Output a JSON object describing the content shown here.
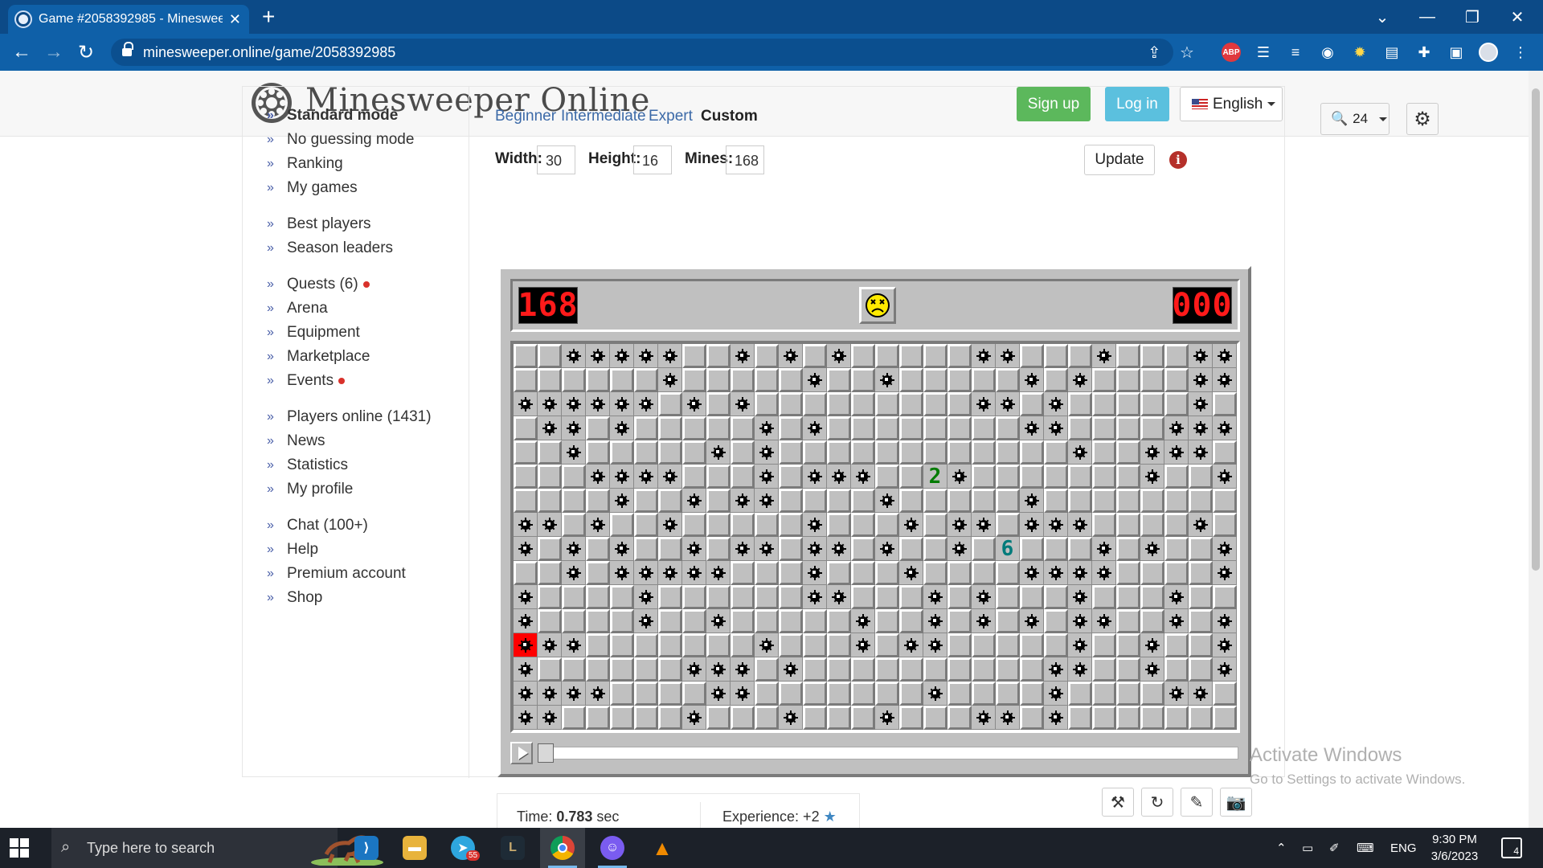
{
  "browser": {
    "tab_title": "Game #2058392985 - Minesweeper Online",
    "url": "minesweeper.online/game/2058392985",
    "extensions": [
      "share-icon",
      "star-icon",
      "adblock-icon",
      "list-icon",
      "pen-icon",
      "wave-icon",
      "bulb-icon",
      "print-icon",
      "puzzle-icon",
      "sidepanel-icon",
      "profile-avatar"
    ],
    "abp_label": "ABP"
  },
  "header": {
    "logo_text": "Minesweeper Online",
    "signup": "Sign up",
    "login": "Log in",
    "language": "English"
  },
  "sidebar": {
    "groups": [
      [
        {
          "label": "Standard mode",
          "bold": true
        },
        {
          "label": "No guessing mode"
        },
        {
          "label": "Ranking"
        },
        {
          "label": "My games"
        }
      ],
      [
        {
          "label": "Best players"
        },
        {
          "label": "Season leaders"
        }
      ],
      [
        {
          "label": "Quests (6)",
          "dot": true
        },
        {
          "label": "Arena"
        },
        {
          "label": "Equipment"
        },
        {
          "label": "Marketplace"
        },
        {
          "label": "Events",
          "dot": true
        }
      ],
      [
        {
          "label": "Players online (1431)"
        },
        {
          "label": "News"
        },
        {
          "label": "Statistics"
        },
        {
          "label": "My profile"
        }
      ],
      [
        {
          "label": "Chat (100+)"
        },
        {
          "label": "Help"
        },
        {
          "label": "Premium account"
        },
        {
          "label": "Shop"
        }
      ]
    ]
  },
  "levels": {
    "beginner": "Beginner",
    "intermediate": "Intermediate",
    "expert": "Expert",
    "custom": "Custom"
  },
  "custom_form": {
    "width_label": "Width:",
    "width_value": "30",
    "height_label": "Height:",
    "height_value": "16",
    "mines_label": "Mines:",
    "mines_value": "168",
    "update_label": "Update",
    "info_glyph": "i"
  },
  "zoom": {
    "value": "24",
    "icon": "magnifier-icon"
  },
  "game": {
    "mines_counter": "168",
    "timer": "000",
    "face": "dead",
    "cols": 30,
    "rows": 16,
    "rows_data": [
      "..MMMMM..M.M.M.....MM...M...MM",
      "......M.....M..M.....M.M....MM",
      "MMMMMM.M.M.........MM.M.....M.",
      ".MM.M.....M.M........MM....MMM",
      "..M.....M.M............M..MMM.",
      "...MMMM...M.MMM..2M.......M..M",
      "....M..M.MM....M.....M........",
      "MM.M..M.....M...M.MM.MMM....M.",
      "M.M.M..M.MM.MM.M..M.6...M.M..M",
      "..M.MMMMM...M...M....MMMM....M",
      "M....M......MM...M.M...M...M..",
      "M....M..M.....M..M.M.M.MM..M.M",
      "XMM.......M...M.MM.....M..M..M",
      "M......MMM.M..........MM..M..M",
      "MMMM....MM.......M....M....MM.",
      "MM.....M...M...M...MM.M......."
    ],
    "number_colors": {
      "2": "#007b00",
      "6": "#007b7b"
    }
  },
  "stats": {
    "time_label": "Time: ",
    "time_value": "0.783",
    "time_unit": " sec",
    "experience": "Experience: +2"
  },
  "watermark": {
    "line1": "Activate Windows",
    "line2": "Go to Settings to activate Windows."
  },
  "taskbar": {
    "search_placeholder": "Type here to search",
    "telegram_badge": "55",
    "tray_lang": "ENG",
    "time": "9:30 PM",
    "date": "3/6/2023",
    "notif_count": "4"
  }
}
